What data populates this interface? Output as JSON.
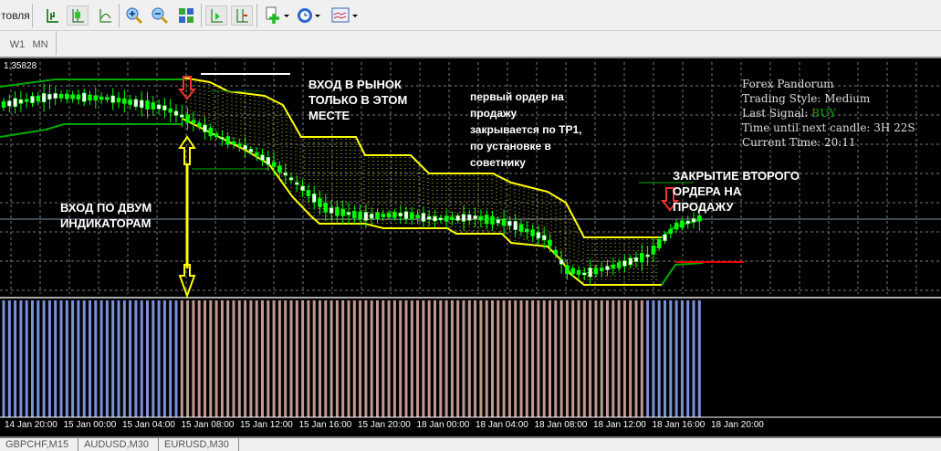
{
  "toolbar": {
    "left_label": "товля",
    "icons": [
      "bar-chart-icon",
      "candlestick-icon",
      "line-chart-icon",
      "zoom-in-icon",
      "zoom-out-icon",
      "tile-windows-icon",
      "chart-shift-icon",
      "autoscroll-icon",
      "add-indicator-icon",
      "periods-icon",
      "templates-icon"
    ]
  },
  "timeframes": [
    "W1",
    "MN"
  ],
  "chart": {
    "price_label": "1.35828",
    "info": {
      "title": "Forex Pandorum",
      "style": "Trading Style: Medium",
      "signal_label": "Last Signal:",
      "signal": "BUY",
      "next_candle": "Time until next candle: 3H 22S",
      "current_time": "Current Time: 20:11"
    },
    "annotations": {
      "entry_market": [
        "ВХОД В РЫНОК",
        "ТОЛЬКО В ЭТОМ",
        "МЕСТЕ"
      ],
      "two_indicators": [
        "ВХОД ПО ДВУМ",
        "ИНДИКАТОРАМ"
      ],
      "first_order": [
        "первый ордер на",
        "продажу",
        "закрывается по TP1,",
        "по установке в",
        "советнику"
      ],
      "second_close": [
        "ЗАКРЫТИЕ ВТОРОГО",
        "ОРДЕРА НА",
        "ПРОДАЖУ"
      ]
    },
    "time_labels": [
      "14 Jan 20:00",
      "15 Jan 00:00",
      "15 Jan 04:00",
      "15 Jan 08:00",
      "15 Jan 12:00",
      "15 Jan 16:00",
      "15 Jan 20:00",
      "18 Jan 00:00",
      "18 Jan 04:00",
      "18 Jan 08:00",
      "18 Jan 12:00",
      "18 Jan 16:00",
      "18 Jan 20:00"
    ],
    "colors": {
      "bull": "#00ff00",
      "band": "#ffff00",
      "channel": "#00aa00",
      "buy": "#00c000",
      "sell": "#a08080"
    }
  },
  "tabs": [
    "GBPCHF,M15",
    "AUDUSD,M30",
    "EURUSD,M30"
  ]
}
